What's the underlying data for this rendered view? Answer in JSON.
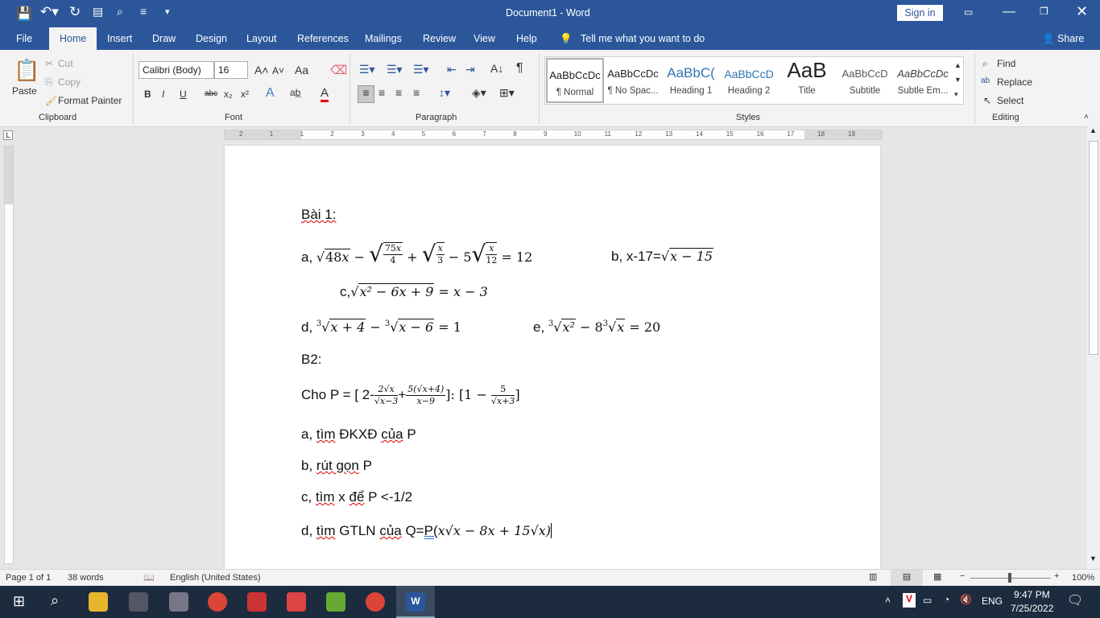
{
  "titlebar": {
    "title": "Document1 - Word",
    "sign_in": "Sign in"
  },
  "tabs": [
    "File",
    "Home",
    "Insert",
    "Draw",
    "Design",
    "Layout",
    "References",
    "Mailings",
    "Review",
    "View",
    "Help"
  ],
  "tell_me": "Tell me what you want to do",
  "share": "Share",
  "clipboard": {
    "paste": "Paste",
    "cut": "Cut",
    "copy": "Copy",
    "format_painter": "Format Painter",
    "label": "Clipboard"
  },
  "font": {
    "name": "Calibri (Body)",
    "size": "16",
    "label": "Font",
    "bold": "B",
    "italic": "I",
    "underline": "U",
    "strike": "abc",
    "sub": "x₂",
    "sup": "x²",
    "case": "Aa"
  },
  "paragraph": {
    "label": "Paragraph"
  },
  "styles": {
    "label": "Styles",
    "items": [
      {
        "sample": "AaBbCcDc",
        "name": "¶ Normal"
      },
      {
        "sample": "AaBbCcDc",
        "name": "¶ No Spac..."
      },
      {
        "sample": "AaBbC(",
        "name": "Heading 1"
      },
      {
        "sample": "AaBbCcD",
        "name": "Heading 2"
      },
      {
        "sample": "AaB",
        "name": "Title"
      },
      {
        "sample": "AaBbCcD",
        "name": "Subtitle"
      },
      {
        "sample": "AaBbCcDc",
        "name": "Subtle Em..."
      }
    ]
  },
  "editing": {
    "find": "Find",
    "replace": "Replace",
    "select": "Select",
    "label": "Editing"
  },
  "ruler_numbers": [
    "2",
    "1",
    "1",
    "2",
    "3",
    "4",
    "5",
    "6",
    "7",
    "8",
    "9",
    "10",
    "11",
    "12",
    "13",
    "14",
    "15",
    "16",
    "17",
    "18",
    "19"
  ],
  "doc": {
    "l1": "Bài 1:",
    "a_pre": "a, ",
    "a_eq": "= 12",
    "b_pre": "b, x-17=",
    "b_rad": "x − 15",
    "c_pre": "c,",
    "c_rad": "x² − 6x + 9",
    "c_rhs": "= x − 3",
    "d_pre": "d, ",
    "d_r1": "x + 4",
    "d_mid": " − ",
    "d_r2": "x − 6",
    "d_rhs": " = 1",
    "e_pre": "e, ",
    "e_r1": "x²",
    "e_mid": " − 8",
    "e_r2": "x",
    "e_rhs": " = 20",
    "b2": "B2:",
    "p_pre": "Cho P = [ 2-",
    "p_n1": "2√x",
    "p_d1": "√x−3",
    "p_plus": "+",
    "p_n2": "5(√x+4)",
    "p_d2": "x−9",
    "p_mid": "]: [1 − ",
    "p_n3": "5",
    "p_d3": "√x+3",
    "p_end": "]",
    "qa": [
      "a, ",
      "tìm",
      " ĐKXĐ ",
      "của",
      " P"
    ],
    "qb": [
      "b, ",
      "rút gọn",
      " P"
    ],
    "qc": [
      "c, ",
      "tìm",
      " x ",
      "để",
      " P <-1/2"
    ],
    "qd": [
      "d, ",
      "tìm",
      " GTLN ",
      "của",
      " Q=",
      "P(",
      "x√x − 8x + 15√x)"
    ]
  },
  "status": {
    "page": "Page 1 of 1",
    "words": "38 words",
    "language": "English (United States)",
    "zoom": "100%",
    "zoom_percent": 100
  },
  "taskbar": {
    "time": "9:47 PM",
    "date": "7/25/2022",
    "lang": "ENG"
  }
}
